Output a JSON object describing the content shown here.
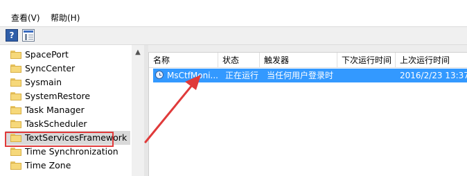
{
  "menubar": {
    "items": [
      "查看(V)",
      "帮助(H)"
    ]
  },
  "toolbar": {
    "buttons": [
      "help-icon",
      "show-hide-console-tree-icon"
    ]
  },
  "tree": {
    "items": [
      "SpacePort",
      "SyncCenter",
      "Sysmain",
      "SystemRestore",
      "Task Manager",
      "TaskScheduler",
      "TextServicesFramework",
      "Time Synchronization",
      "Time Zone"
    ],
    "selected_index": 6,
    "help_text": "?"
  },
  "list": {
    "columns": [
      "名称",
      "状态",
      "触发器",
      "下次运行时间",
      "上次运行时间"
    ],
    "rows": [
      {
        "name": "MsCtfMoni...",
        "status": "正在运行",
        "trigger": "当任何用户登录时",
        "next_run": "",
        "last_run": "2016/2/23 13:37:"
      }
    ]
  },
  "annotation": {
    "highlight_color": "#e03a3a",
    "arrow_color": "#e03a3a"
  },
  "colors": {
    "selection": "#3399ff",
    "folder": "#f6d87a"
  }
}
